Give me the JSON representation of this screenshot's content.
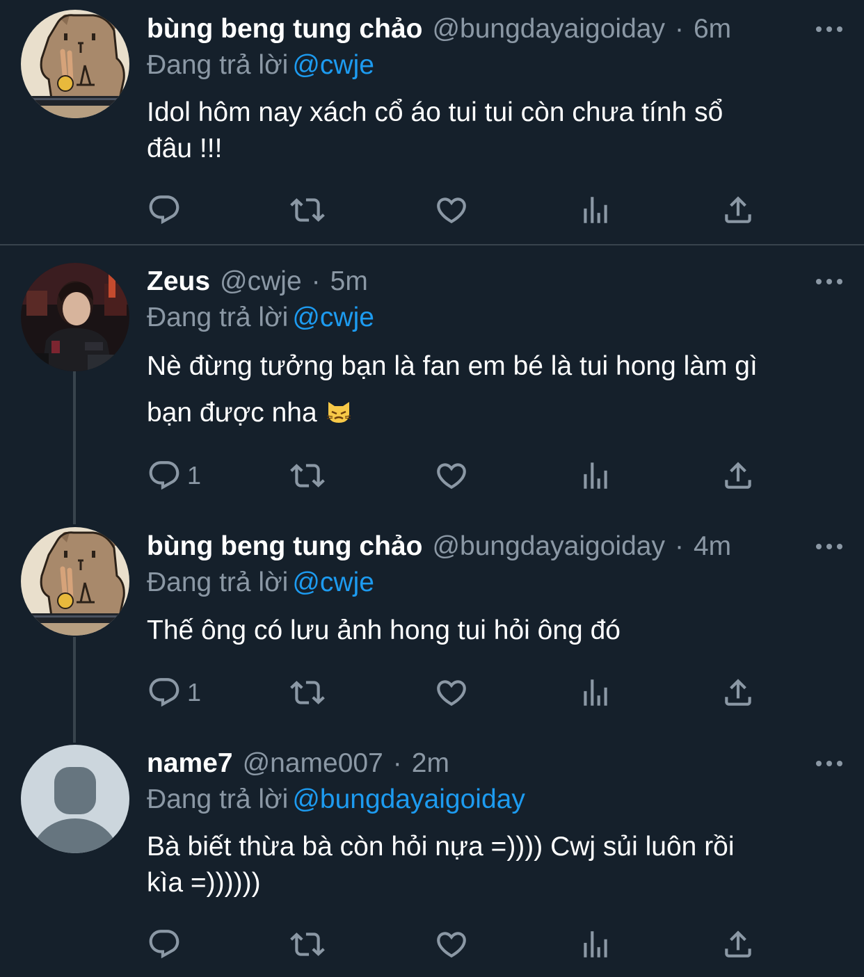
{
  "tweets": [
    {
      "display_name": "bùng beng tung chảo",
      "handle": "@bungdayaigoiday",
      "separator": "·",
      "time": "6m",
      "replying_prefix": "Đang trả lời",
      "replying_to": "@cwje",
      "text_line1": "Idol hôm nay xách cổ áo tui tui còn chưa tính sổ",
      "text_line2": "đâu !!!",
      "reply_count": "",
      "avatar": "capybara-avatar"
    },
    {
      "display_name": "Zeus",
      "handle": "@cwje",
      "separator": "·",
      "time": "5m",
      "replying_prefix": "Đang trả lời",
      "replying_to": "@cwje",
      "text_line1": "Nè đừng tưởng bạn là fan em bé là tui hong làm gì",
      "text_line2": "bạn được nha",
      "emoji": "pouting-cat-emoji",
      "reply_count": "1",
      "avatar": "gamer-photo-avatar"
    },
    {
      "display_name": "bùng beng tung chảo",
      "handle": "@bungdayaigoiday",
      "separator": "·",
      "time": "4m",
      "replying_prefix": "Đang trả lời",
      "replying_to": "@cwje",
      "text_line1": "Thế ông có lưu ảnh hong tui hỏi ông đó",
      "reply_count": "1",
      "avatar": "capybara-avatar"
    },
    {
      "display_name": "name7",
      "handle": "@name007",
      "separator": "·",
      "time": "2m",
      "replying_prefix": "Đang trả lời",
      "replying_to": "@bungdayaigoiday",
      "text_line1": "Bà biết thừa bà còn hỏi nựa =)))) Cwj sủi luôn rồi",
      "text_line2": "kìa =))))))",
      "reply_count": "",
      "avatar": "default-avatar"
    }
  ],
  "icons": [
    "reply-icon",
    "retweet-icon",
    "like-icon",
    "views-icon",
    "share-icon",
    "more-icon"
  ],
  "colors": {
    "background": "#15202b",
    "secondary_text": "#8b98a5",
    "link": "#1d9bf0",
    "divider": "#38444d"
  }
}
